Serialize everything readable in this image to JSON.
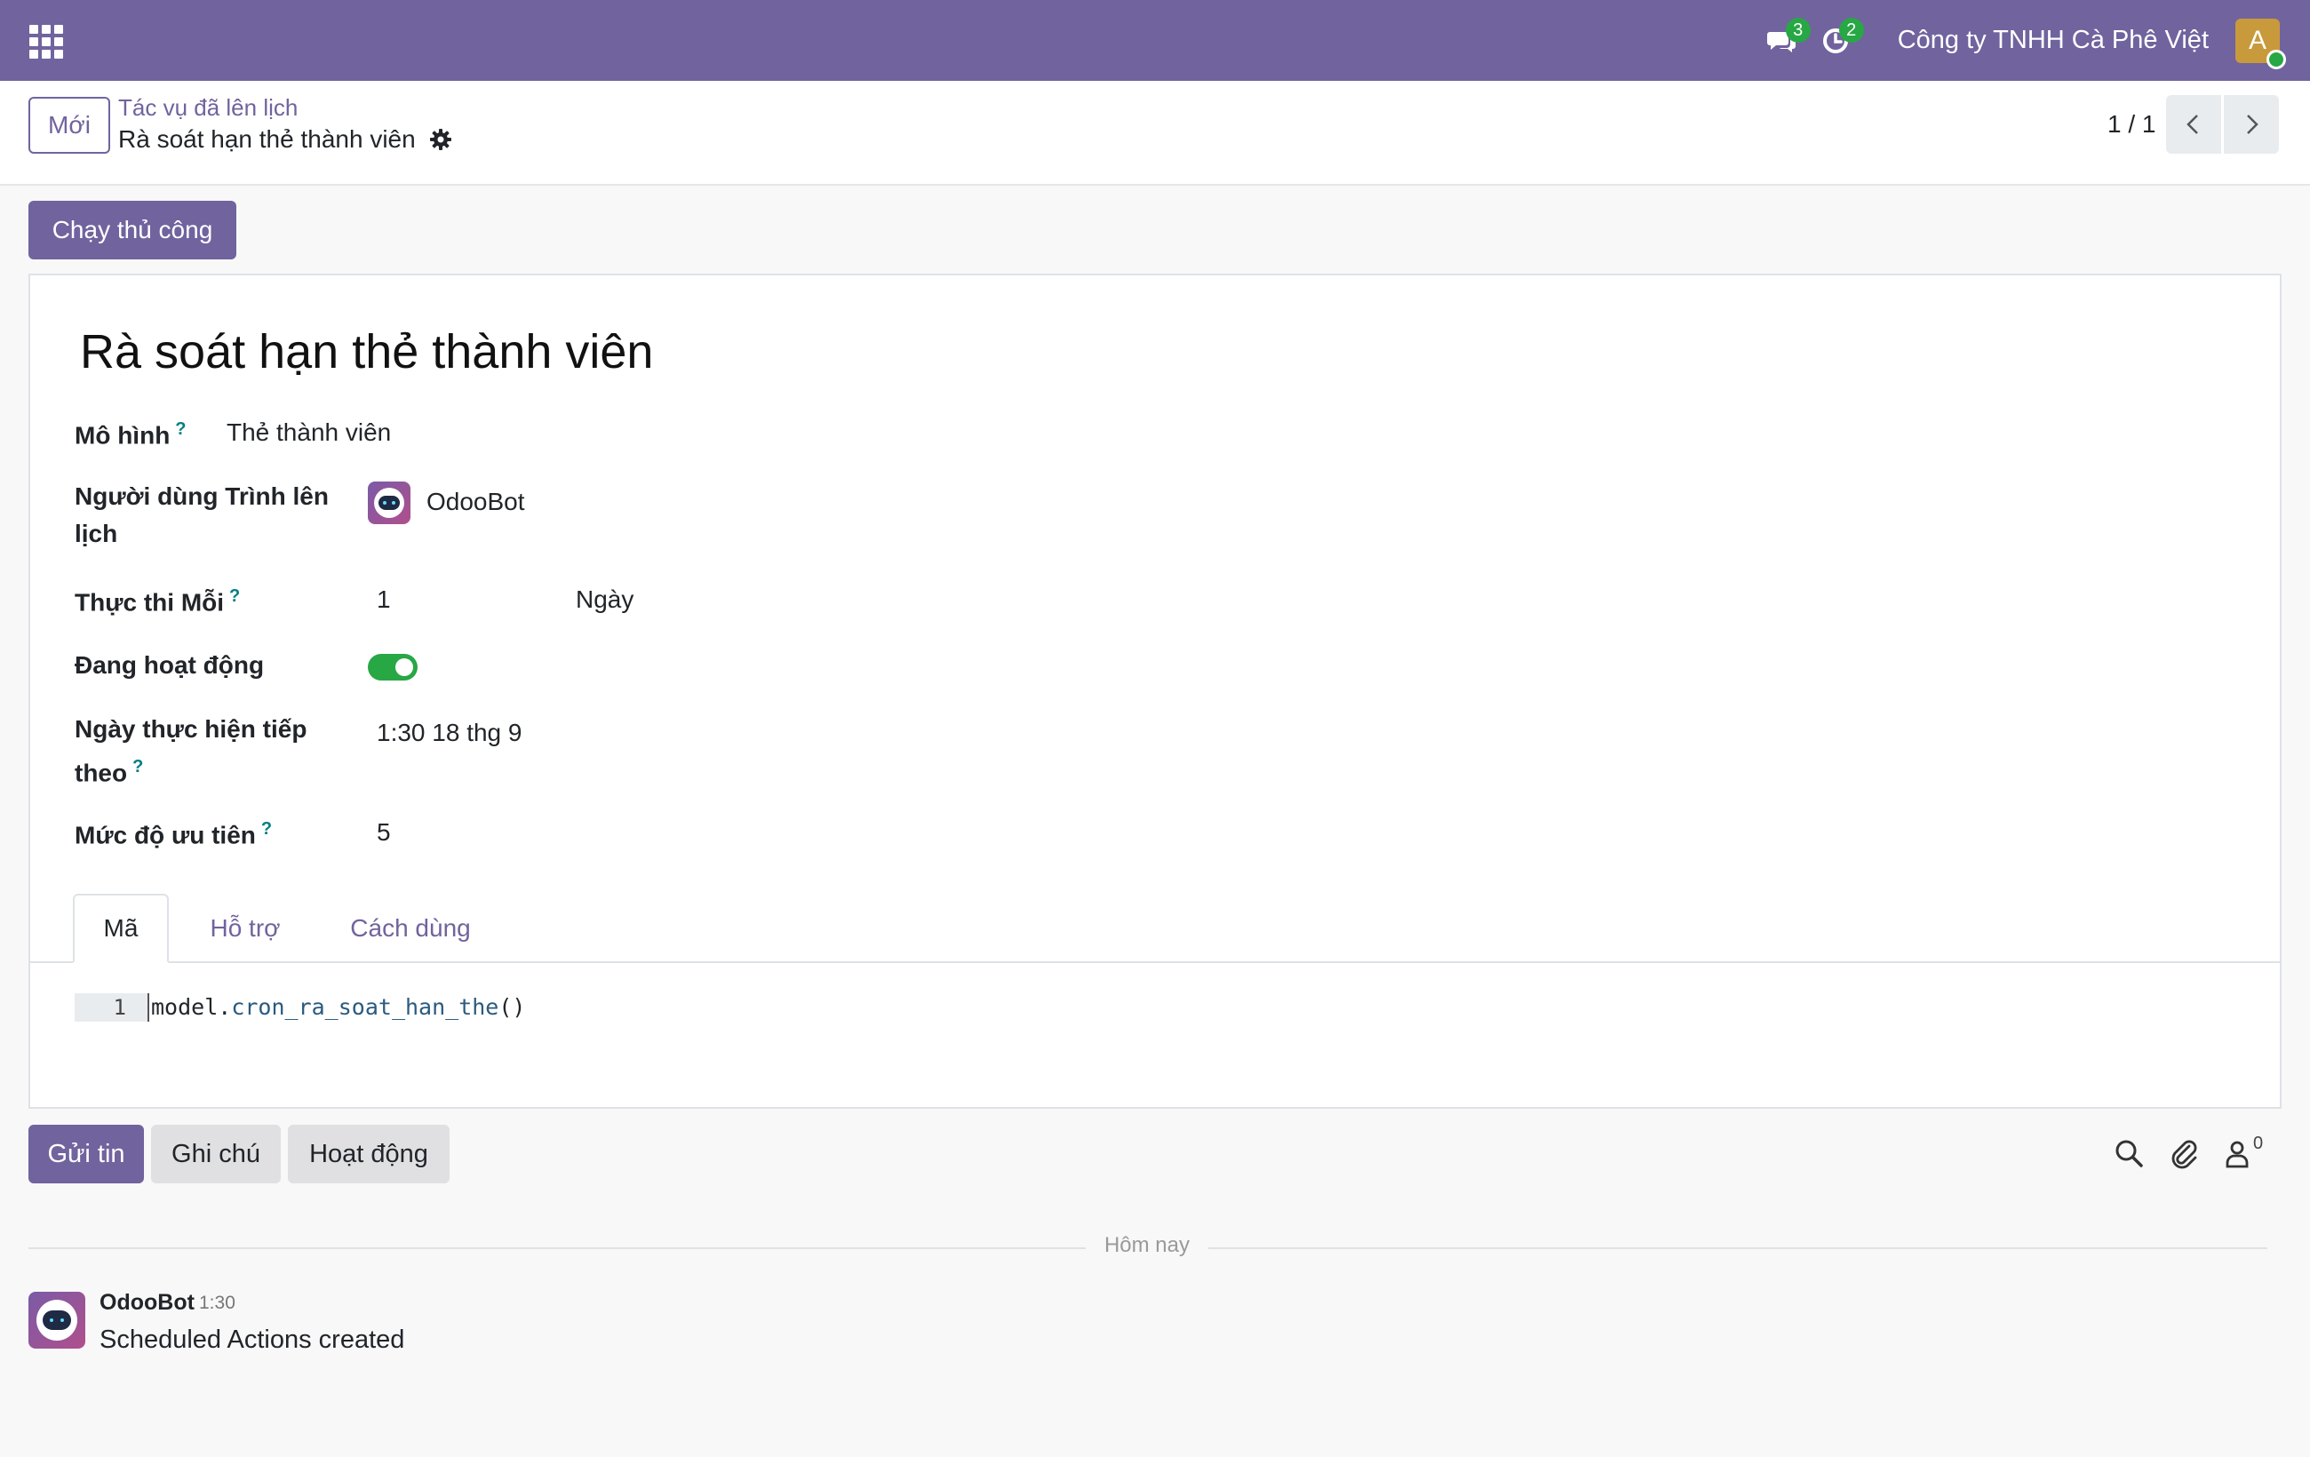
{
  "navbar": {
    "messages_badge": "3",
    "activities_badge": "2",
    "company": "Công ty TNHH Cà Phê Việt",
    "user_initial": "A"
  },
  "control_panel": {
    "new_label": "Mới",
    "breadcrumb_parent": "Tác vụ đã lên lịch",
    "breadcrumb_current": "Rà soát hạn thẻ thành viên",
    "pager": "1 / 1"
  },
  "actions": {
    "run_manually": "Chạy thủ công"
  },
  "form": {
    "title": "Rà soát hạn thẻ thành viên",
    "help_mark": "?",
    "fields": {
      "model": {
        "label": "Mô hình",
        "value": "Thẻ thành viên"
      },
      "scheduler_user": {
        "label_line1": "Người dùng Trình lên",
        "label_line2": "lịch",
        "value": "OdooBot"
      },
      "execute_every": {
        "label": "Thực thi Mỗi",
        "value": "1",
        "unit": "Ngày"
      },
      "active": {
        "label": "Đang hoạt động",
        "value": true
      },
      "next_execution": {
        "label_line1": "Ngày thực hiện tiếp",
        "label_line2": "theo",
        "value": "1:30 18 thg 9"
      },
      "priority": {
        "label": "Mức độ ưu tiên",
        "value": "5"
      }
    },
    "tabs": [
      {
        "label": "Mã",
        "active": true
      },
      {
        "label": "Hỗ trợ",
        "active": false
      },
      {
        "label": "Cách dùng",
        "active": false
      }
    ],
    "code": {
      "line_number": "1",
      "object": "model",
      "dot": ".",
      "method": "cron_ra_soat_han_the",
      "parens": "()"
    }
  },
  "chatter": {
    "send_message": "Gửi tin",
    "log_note": "Ghi chú",
    "activities": "Hoạt động",
    "followers_count": "0",
    "date_separator": "Hôm nay",
    "messages": [
      {
        "author": "OdooBot",
        "time": "1:30",
        "body": "Scheduled Actions created"
      }
    ]
  },
  "colors": {
    "brand": "#71639e",
    "success": "#28a745",
    "help": "#017e84"
  }
}
